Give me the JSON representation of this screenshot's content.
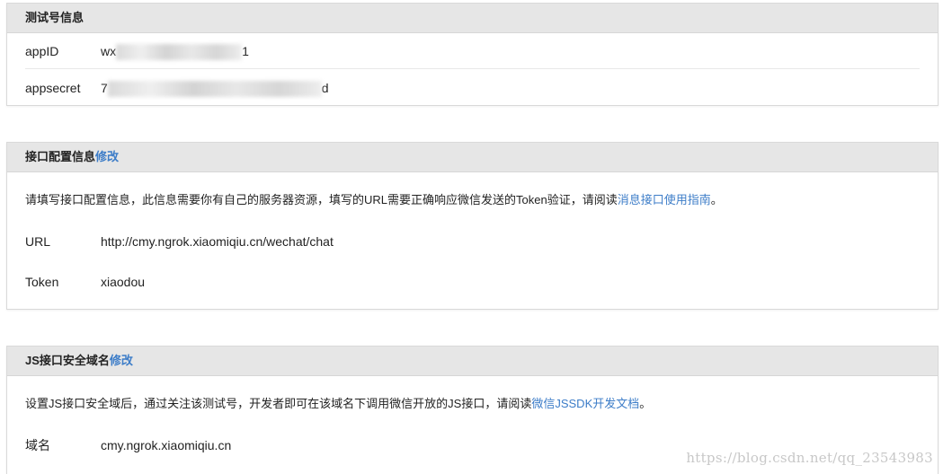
{
  "test_account": {
    "title": "测试号信息",
    "appid_label": "appID",
    "appid_value": "wx",
    "appid_tail": "1",
    "appsecret_label": "appsecret",
    "appsecret_value": "7",
    "appsecret_tail": "d"
  },
  "interface_config": {
    "title": "接口配置信息",
    "edit_link": "修改",
    "description": "请填写接口配置信息，此信息需要你有自己的服务器资源，填写的URL需要正确响应微信发送的Token验证，请阅读",
    "guide_link": "消息接口使用指南",
    "description_end": "。",
    "url_label": "URL",
    "url_value": "http://cmy.ngrok.xiaomiqiu.cn/wechat/chat",
    "token_label": "Token",
    "token_value": "xiaodou"
  },
  "js_domain": {
    "title": "JS接口安全域名",
    "edit_link": "修改",
    "description": "设置JS接口安全域后，通过关注该测试号，开发者即可在该域名下调用微信开放的JS接口，请阅读",
    "doc_link": "微信JSSDK开发文档",
    "description_end": "。",
    "domain_label": "域名",
    "domain_value": "cmy.ngrok.xiaomiqiu.cn"
  },
  "watermark": "https://blog.csdn.net/qq_23543983",
  "colors": {
    "link": "#3d7dc8",
    "header_bg": "#e6e6e6",
    "border": "#d9d9d9"
  }
}
